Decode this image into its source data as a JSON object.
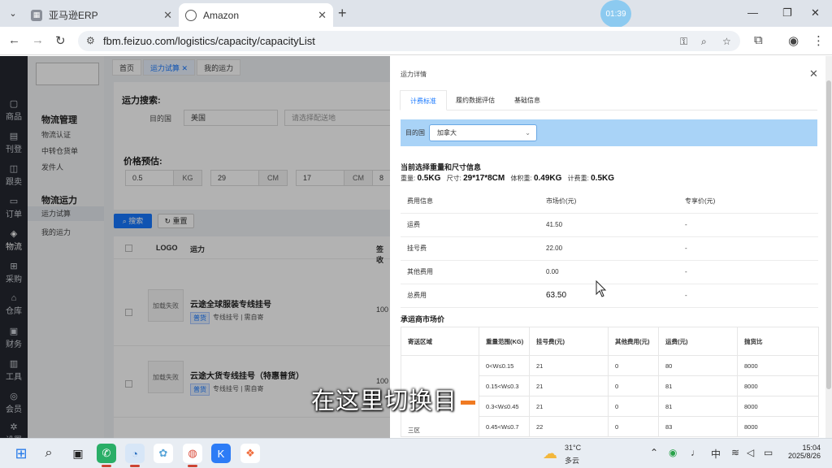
{
  "browser": {
    "tabs": [
      {
        "label": "亚马逊ERP"
      },
      {
        "label": "Amazon"
      }
    ],
    "timer": "01:39",
    "url": "fbm.feizuo.com/logistics/capacity/capacityList"
  },
  "appnav": {
    "items": [
      "商品",
      "刊登",
      "跟卖",
      "订单",
      "物流",
      "采购",
      "仓库",
      "财务",
      "工具",
      "会员",
      "设置"
    ]
  },
  "subside": {
    "group1": "物流管理",
    "group1_items": [
      "物流认证",
      "中转仓货单",
      "发件人"
    ],
    "group2": "物流运力",
    "group2_items": [
      "运力试算",
      "我的运力"
    ]
  },
  "main": {
    "tabs": [
      "首页",
      "运力试算",
      "我的运力"
    ],
    "search_label": "运力搜索:",
    "dest_label": "目的国",
    "dest_value": "美国",
    "carrier_placeholder": "请选择配送地",
    "price_label": "价格预估:",
    "weight_value": "0.5",
    "weight_unit": "KG",
    "length_value": "29",
    "length_unit": "CM",
    "width_value": "17",
    "width_unit": "CM",
    "height_value": "8",
    "search_btn": "搜索",
    "reset_btn": "重置",
    "table": {
      "col_logo": "LOGO",
      "col_name": "运力",
      "col_sign": "签收",
      "rows": [
        {
          "img": "加载失败",
          "name": "云途全球服装专线挂号",
          "tag": "普货",
          "tags2": "专线挂号 | 需自寄",
          "sign": "100"
        },
        {
          "img": "加载失败",
          "name": "云途大货专线挂号（特惠普货）",
          "tag": "普货",
          "tags2": "专线挂号 | 需自寄",
          "sign": "100"
        }
      ]
    }
  },
  "drawer": {
    "title": "运力详情",
    "tabs": [
      "计费标准",
      "履约数据评估",
      "基础信息"
    ],
    "dest_label": "目的国",
    "dest_value": "加拿大",
    "section1": "当前选择重量和尺寸信息",
    "dims": {
      "weight_label": "重量:",
      "weight": "0.5KG",
      "size_label": "尺寸:",
      "size": "29*17*8CM",
      "vol_label": "体积重:",
      "vol": "0.49KG",
      "bill_label": "计费重:",
      "bill": "0.5KG"
    },
    "fee_table": {
      "headers": [
        "费用信息",
        "市场价(元)",
        "专享价(元)"
      ],
      "rows": [
        [
          "运费",
          "41.50",
          "-"
        ],
        [
          "挂号费",
          "22.00",
          "-"
        ],
        [
          "其他费用",
          "0.00",
          "-"
        ],
        [
          "总费用",
          "63.50",
          "-"
        ]
      ]
    },
    "section2": "承运商市场价",
    "carrier_table": {
      "headers": [
        "寄送区域",
        "重量范围(KG)",
        "挂号费(元)",
        "其他费用(元)",
        "运费(元)",
        "抛货比"
      ],
      "region": "三区",
      "rows": [
        [
          "0<W≤0.15",
          "21",
          "0",
          "80",
          "8000"
        ],
        [
          "0.15<W≤0.3",
          "21",
          "0",
          "81",
          "8000"
        ],
        [
          "0.3<W≤0.45",
          "21",
          "0",
          "81",
          "8000"
        ],
        [
          "0.45<W≤0.7",
          "22",
          "0",
          "83",
          "8000"
        ]
      ]
    }
  },
  "subtitle": "在这里切换目",
  "taskbar": {
    "temp": "31°C",
    "weather": "多云",
    "ime": "中",
    "time": "15:04",
    "date": "2025/8/26"
  },
  "colors": {
    "accent": "#1677ff",
    "dest_bar": "#a9d3f7",
    "nav_dark": "#252830"
  }
}
